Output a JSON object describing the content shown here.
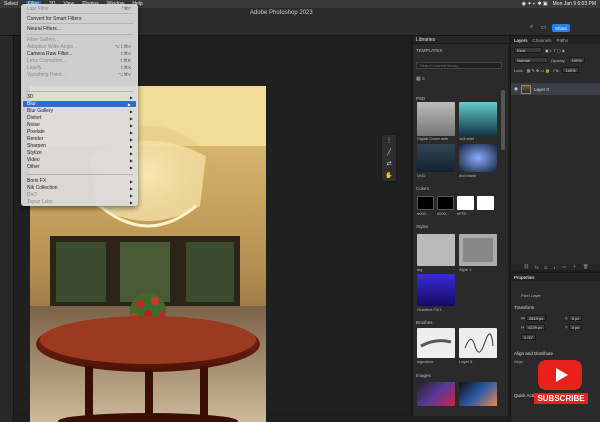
{
  "app": {
    "title": "Adobe Photoshop 2023",
    "share_label": "Share"
  },
  "menubar": {
    "items": [
      "Select",
      "Filter",
      "3D",
      "View",
      "Plugins",
      "Window",
      "Help"
    ],
    "clock": "Mon Jan 9  6:03 PM"
  },
  "filter_menu": {
    "items": [
      {
        "label": "Last Filter",
        "shortcut": "^⌘F",
        "dim": true
      },
      {
        "label": "Convert for Smart Filters"
      },
      {
        "label": "Neural Filters..."
      },
      {
        "label": "Filter Gallery...",
        "dim": true
      },
      {
        "label": "Adaptive Wide Angle...",
        "shortcut": "⌥⇧⌘A",
        "dim": true
      },
      {
        "label": "Camera Raw Filter...",
        "shortcut": "⇧⌘A"
      },
      {
        "label": "Lens Correction...",
        "shortcut": "⇧⌘R",
        "dim": true
      },
      {
        "label": "Liquify...",
        "shortcut": "⇧⌘X",
        "dim": true
      },
      {
        "label": "Vanishing Point...",
        "shortcut": "⌥⌘V",
        "dim": true
      },
      {
        "label": "3D",
        "submenu": true
      },
      {
        "label": "Blur",
        "submenu": true,
        "highlighted": true
      },
      {
        "label": "Blur Gallery",
        "submenu": true
      },
      {
        "label": "Distort",
        "submenu": true
      },
      {
        "label": "Noise",
        "submenu": true
      },
      {
        "label": "Pixelate",
        "submenu": true
      },
      {
        "label": "Render",
        "submenu": true
      },
      {
        "label": "Sharpen",
        "submenu": true
      },
      {
        "label": "Stylize",
        "submenu": true
      },
      {
        "label": "Video",
        "submenu": true
      },
      {
        "label": "Other",
        "submenu": true
      },
      {
        "label": "Boris FX",
        "submenu": true
      },
      {
        "label": "Nik Collection",
        "submenu": true
      },
      {
        "label": "DxO",
        "submenu": true,
        "dim": true
      },
      {
        "label": "Topaz Labs",
        "submenu": true,
        "dim": true
      }
    ]
  },
  "libraries": {
    "title": "Libraries",
    "templates_label": "TEMPLATES",
    "search_placeholder": "Search current library",
    "sections": {
      "psd": "PSD",
      "colors": "Colors",
      "styles": "Styles",
      "brushes": "Brushes",
      "images": "Images"
    },
    "psd_items": [
      "Digital Cover web",
      "cs3-shirt",
      "DVD",
      "dvd blank"
    ],
    "colors": [
      {
        "hex": "#000000",
        "label": "#000..."
      },
      {
        "hex": "#000000",
        "label": "#000..."
      },
      {
        "hex": "#ffffff",
        "label": "#FFF..."
      },
      {
        "hex": "#ffffff",
        "label": ""
      }
    ],
    "style_items": [
      "big",
      "Style 1",
      "Gradient Fill 1"
    ],
    "brush_items": [
      "signature",
      "Layer 5"
    ]
  },
  "layers": {
    "tabs": [
      "Layers",
      "Channels",
      "Paths"
    ],
    "kind_label": "Kind",
    "blend_mode": "Normal",
    "opacity_label": "Opacity:",
    "opacity_value": "100%",
    "lock_label": "Lock:",
    "fill_label": "Fill:",
    "fill_value": "100%",
    "layer_name": "Layer 0"
  },
  "properties": {
    "title": "Properties",
    "pixel_layer": "Pixel Layer",
    "transform": "Transform",
    "w_label": "W",
    "w_value": "2819 px",
    "h_label": "H",
    "h_value": "4229 px",
    "x_label": "X",
    "x_value": "0 px",
    "y_label": "Y",
    "y_value": "0 px",
    "angle": "0.00°",
    "align_distribute": "Align and Distribute",
    "align": "Align",
    "quick_actions": "Quick Actions"
  },
  "overlay": {
    "subscribe": "SUBSCRIBE"
  },
  "icons": {
    "play": "youtube-play-icon",
    "arrow": "submenu-arrow-icon"
  }
}
